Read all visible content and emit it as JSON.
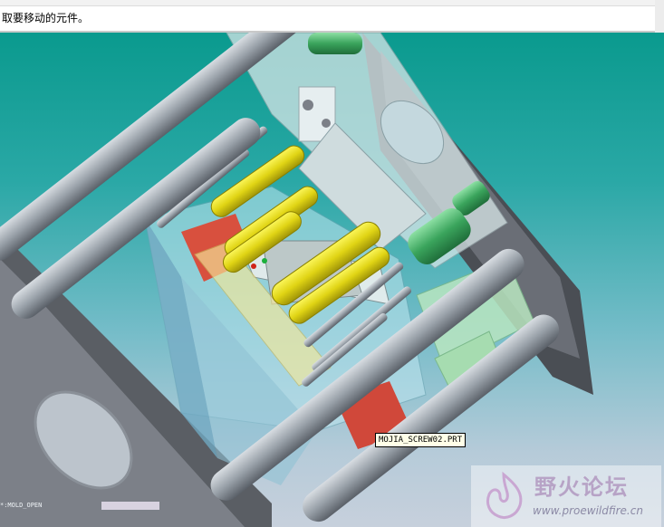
{
  "message": {
    "text": "取要移动的元件。"
  },
  "viewport": {
    "component_tooltip": "MOJIA_SCREW02.PRT",
    "model_label": "*:MOLD_OPEN"
  },
  "watermark": {
    "title": "野火论坛",
    "url": "www.proewildfire.cn"
  },
  "colors": {
    "background_top": "#0a9a8e",
    "background_bottom": "#c7d0dc",
    "tie_bar": "#9ea6ae",
    "platen": "#4a4e54",
    "yellow_part": "#e6df1c",
    "green_part": "#4cb26c",
    "red_part": "#d24d3e",
    "glass_part": "#bfe0e6"
  }
}
